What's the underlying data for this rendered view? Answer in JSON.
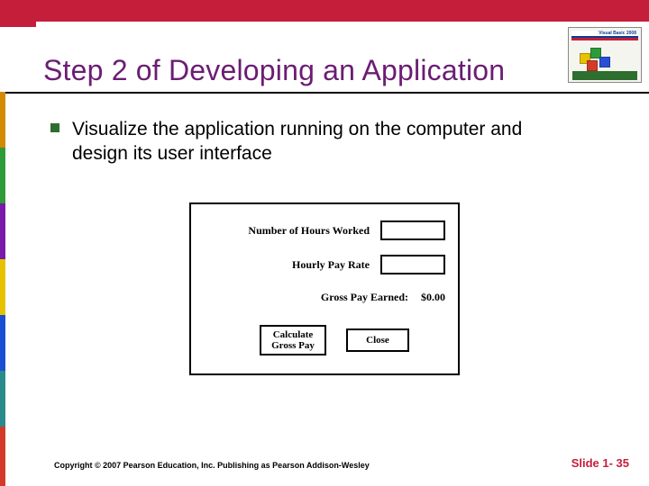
{
  "title": "Step 2 of Developing an Application",
  "bullet": "Visualize the application running on the computer and design its user interface",
  "sketch": {
    "hours_label": "Number of Hours Worked",
    "rate_label": "Hourly Pay Rate",
    "gross_label": "Gross Pay Earned:",
    "gross_value": "$0.00",
    "calc_btn": "Calculate Gross Pay",
    "close_btn": "Close"
  },
  "footer": {
    "copyright": "Copyright © 2007 Pearson Education, Inc. Publishing as Pearson Addison-Wesley",
    "slide": "Slide 1- 35"
  },
  "thumb": {
    "product": "Visual Basic 2008"
  }
}
